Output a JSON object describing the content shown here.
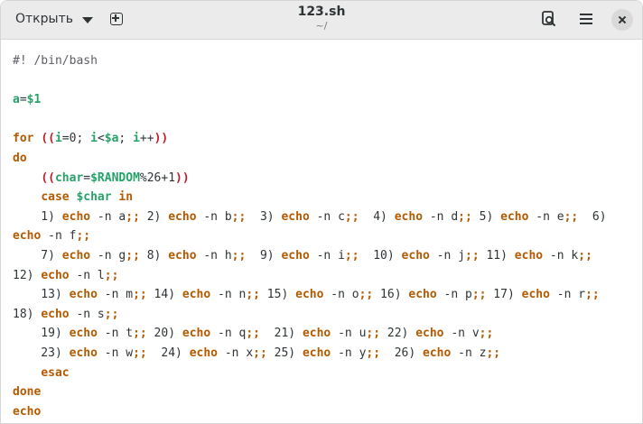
{
  "header": {
    "open_label": "Открыть",
    "title": "123.sh",
    "subtitle": "~/"
  },
  "colors": {
    "keyword": "#b35a00",
    "variable": "#26a269",
    "paren": "#c01c28",
    "comment": "#5e5c64",
    "text": "#2e3436"
  },
  "editor": {
    "lines": [
      [
        {
          "t": "comment",
          "v": "#! /bin/bash"
        }
      ],
      [],
      [
        {
          "t": "var",
          "v": "a"
        },
        {
          "t": "op",
          "v": "="
        },
        {
          "t": "var",
          "v": "$1"
        }
      ],
      [],
      [
        {
          "t": "keyword",
          "v": "for"
        },
        {
          "t": "plain",
          "v": " "
        },
        {
          "t": "paren",
          "v": "(("
        },
        {
          "t": "var",
          "v": "i"
        },
        {
          "t": "op",
          "v": "=0; "
        },
        {
          "t": "var",
          "v": "i"
        },
        {
          "t": "op",
          "v": "<"
        },
        {
          "t": "var",
          "v": "$a"
        },
        {
          "t": "op",
          "v": "; "
        },
        {
          "t": "var",
          "v": "i"
        },
        {
          "t": "op",
          "v": "++"
        },
        {
          "t": "paren",
          "v": "))"
        }
      ],
      [
        {
          "t": "keyword",
          "v": "do"
        }
      ],
      [
        {
          "t": "plain",
          "v": "    "
        },
        {
          "t": "paren",
          "v": "(("
        },
        {
          "t": "var",
          "v": "char"
        },
        {
          "t": "op",
          "v": "="
        },
        {
          "t": "var",
          "v": "$RANDOM"
        },
        {
          "t": "op",
          "v": "%26+1"
        },
        {
          "t": "paren",
          "v": "))"
        }
      ],
      [
        {
          "t": "plain",
          "v": "    "
        },
        {
          "t": "keyword",
          "v": "case"
        },
        {
          "t": "plain",
          "v": " "
        },
        {
          "t": "var",
          "v": "$char"
        },
        {
          "t": "plain",
          "v": " "
        },
        {
          "t": "keyword",
          "v": "in"
        }
      ],
      [
        {
          "t": "plain",
          "v": "    1) "
        },
        {
          "t": "builtin",
          "v": "echo"
        },
        {
          "t": "plain",
          "v": " -n a"
        },
        {
          "t": "keyword",
          "v": ";;"
        },
        {
          "t": "plain",
          "v": " 2) "
        },
        {
          "t": "builtin",
          "v": "echo"
        },
        {
          "t": "plain",
          "v": " -n b"
        },
        {
          "t": "keyword",
          "v": ";;"
        },
        {
          "t": "plain",
          "v": "  3) "
        },
        {
          "t": "builtin",
          "v": "echo"
        },
        {
          "t": "plain",
          "v": " -n c"
        },
        {
          "t": "keyword",
          "v": ";;"
        },
        {
          "t": "plain",
          "v": "  4) "
        },
        {
          "t": "builtin",
          "v": "echo"
        },
        {
          "t": "plain",
          "v": " -n d"
        },
        {
          "t": "keyword",
          "v": ";;"
        },
        {
          "t": "plain",
          "v": " 5) "
        },
        {
          "t": "builtin",
          "v": "echo"
        },
        {
          "t": "plain",
          "v": " -n e"
        },
        {
          "t": "keyword",
          "v": ";;"
        },
        {
          "t": "plain",
          "v": "  6)"
        }
      ],
      [
        {
          "t": "builtin",
          "v": "echo"
        },
        {
          "t": "plain",
          "v": " -n f"
        },
        {
          "t": "keyword",
          "v": ";;"
        }
      ],
      [
        {
          "t": "plain",
          "v": "    7) "
        },
        {
          "t": "builtin",
          "v": "echo"
        },
        {
          "t": "plain",
          "v": " -n g"
        },
        {
          "t": "keyword",
          "v": ";;"
        },
        {
          "t": "plain",
          "v": " 8) "
        },
        {
          "t": "builtin",
          "v": "echo"
        },
        {
          "t": "plain",
          "v": " -n h"
        },
        {
          "t": "keyword",
          "v": ";;"
        },
        {
          "t": "plain",
          "v": "  9) "
        },
        {
          "t": "builtin",
          "v": "echo"
        },
        {
          "t": "plain",
          "v": " -n i"
        },
        {
          "t": "keyword",
          "v": ";;"
        },
        {
          "t": "plain",
          "v": "  10) "
        },
        {
          "t": "builtin",
          "v": "echo"
        },
        {
          "t": "plain",
          "v": " -n j"
        },
        {
          "t": "keyword",
          "v": ";;"
        },
        {
          "t": "plain",
          "v": " 11) "
        },
        {
          "t": "builtin",
          "v": "echo"
        },
        {
          "t": "plain",
          "v": " -n k"
        },
        {
          "t": "keyword",
          "v": ";;"
        }
      ],
      [
        {
          "t": "plain",
          "v": "12) "
        },
        {
          "t": "builtin",
          "v": "echo"
        },
        {
          "t": "plain",
          "v": " -n l"
        },
        {
          "t": "keyword",
          "v": ";;"
        }
      ],
      [
        {
          "t": "plain",
          "v": "    13) "
        },
        {
          "t": "builtin",
          "v": "echo"
        },
        {
          "t": "plain",
          "v": " -n m"
        },
        {
          "t": "keyword",
          "v": ";;"
        },
        {
          "t": "plain",
          "v": " 14) "
        },
        {
          "t": "builtin",
          "v": "echo"
        },
        {
          "t": "plain",
          "v": " -n n"
        },
        {
          "t": "keyword",
          "v": ";;"
        },
        {
          "t": "plain",
          "v": " 15) "
        },
        {
          "t": "builtin",
          "v": "echo"
        },
        {
          "t": "plain",
          "v": " -n o"
        },
        {
          "t": "keyword",
          "v": ";;"
        },
        {
          "t": "plain",
          "v": " 16) "
        },
        {
          "t": "builtin",
          "v": "echo"
        },
        {
          "t": "plain",
          "v": " -n p"
        },
        {
          "t": "keyword",
          "v": ";;"
        },
        {
          "t": "plain",
          "v": " 17) "
        },
        {
          "t": "builtin",
          "v": "echo"
        },
        {
          "t": "plain",
          "v": " -n r"
        },
        {
          "t": "keyword",
          "v": ";;"
        }
      ],
      [
        {
          "t": "plain",
          "v": "18) "
        },
        {
          "t": "builtin",
          "v": "echo"
        },
        {
          "t": "plain",
          "v": " -n s"
        },
        {
          "t": "keyword",
          "v": ";;"
        }
      ],
      [
        {
          "t": "plain",
          "v": "    19) "
        },
        {
          "t": "builtin",
          "v": "echo"
        },
        {
          "t": "plain",
          "v": " -n t"
        },
        {
          "t": "keyword",
          "v": ";;"
        },
        {
          "t": "plain",
          "v": " 20) "
        },
        {
          "t": "builtin",
          "v": "echo"
        },
        {
          "t": "plain",
          "v": " -n q"
        },
        {
          "t": "keyword",
          "v": ";;"
        },
        {
          "t": "plain",
          "v": "  21) "
        },
        {
          "t": "builtin",
          "v": "echo"
        },
        {
          "t": "plain",
          "v": " -n u"
        },
        {
          "t": "keyword",
          "v": ";;"
        },
        {
          "t": "plain",
          "v": " 22) "
        },
        {
          "t": "builtin",
          "v": "echo"
        },
        {
          "t": "plain",
          "v": " -n v"
        },
        {
          "t": "keyword",
          "v": ";;"
        }
      ],
      [
        {
          "t": "plain",
          "v": "    23) "
        },
        {
          "t": "builtin",
          "v": "echo"
        },
        {
          "t": "plain",
          "v": " -n w"
        },
        {
          "t": "keyword",
          "v": ";;"
        },
        {
          "t": "plain",
          "v": "  24) "
        },
        {
          "t": "builtin",
          "v": "echo"
        },
        {
          "t": "plain",
          "v": " -n x"
        },
        {
          "t": "keyword",
          "v": ";;"
        },
        {
          "t": "plain",
          "v": " 25) "
        },
        {
          "t": "builtin",
          "v": "echo"
        },
        {
          "t": "plain",
          "v": " -n y"
        },
        {
          "t": "keyword",
          "v": ";;"
        },
        {
          "t": "plain",
          "v": "  26) "
        },
        {
          "t": "builtin",
          "v": "echo"
        },
        {
          "t": "plain",
          "v": " -n z"
        },
        {
          "t": "keyword",
          "v": ";;"
        }
      ],
      [
        {
          "t": "plain",
          "v": "    "
        },
        {
          "t": "keyword",
          "v": "esac"
        }
      ],
      [
        {
          "t": "keyword",
          "v": "done"
        }
      ],
      [
        {
          "t": "builtin",
          "v": "echo"
        }
      ]
    ]
  }
}
